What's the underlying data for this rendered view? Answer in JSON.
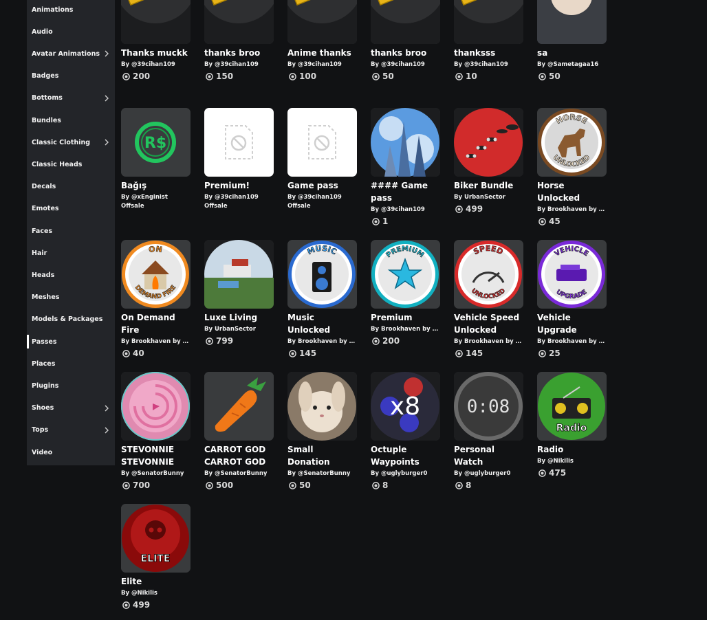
{
  "sidebar": {
    "items": [
      {
        "label": "Animations",
        "chevron": false
      },
      {
        "label": "Audio",
        "chevron": false
      },
      {
        "label": "Avatar Animations",
        "chevron": true
      },
      {
        "label": "Badges",
        "chevron": false
      },
      {
        "label": "Bottoms",
        "chevron": true
      },
      {
        "label": "Bundles",
        "chevron": false
      },
      {
        "label": "Classic Clothing",
        "chevron": true
      },
      {
        "label": "Classic Heads",
        "chevron": false
      },
      {
        "label": "Decals",
        "chevron": false
      },
      {
        "label": "Emotes",
        "chevron": false
      },
      {
        "label": "Faces",
        "chevron": false
      },
      {
        "label": "Hair",
        "chevron": false
      },
      {
        "label": "Heads",
        "chevron": false
      },
      {
        "label": "Meshes",
        "chevron": false
      },
      {
        "label": "Models & Packages",
        "chevron": false
      },
      {
        "label": "Passes",
        "chevron": false,
        "active": true
      },
      {
        "label": "Places",
        "chevron": false
      },
      {
        "label": "Plugins",
        "chevron": false
      },
      {
        "label": "Shoes",
        "chevron": true
      },
      {
        "label": "Tops",
        "chevron": true
      },
      {
        "label": "Video",
        "chevron": false
      }
    ]
  },
  "items": [
    {
      "name": "Thanks muckk",
      "creator": "By @39cihan109",
      "price": "200",
      "thumb": "ticket"
    },
    {
      "name": "thanks broo",
      "creator": "By @39cihan109",
      "price": "150",
      "thumb": "ticket"
    },
    {
      "name": "Anime thanks",
      "creator": "By @39cihan109",
      "price": "100",
      "thumb": "ticket"
    },
    {
      "name": "thanks broo",
      "creator": "By @39cihan109",
      "price": "50",
      "thumb": "ticket"
    },
    {
      "name": "thanksss",
      "creator": "By @39cihan109",
      "price": "10",
      "thumb": "ticket"
    },
    {
      "name": "sa",
      "creator": "By @Sametagaa16",
      "price": "50",
      "thumb": "anime"
    },
    {
      "name": "Bağış",
      "creator": "By @xEnginist",
      "offsale": "Offsale",
      "thumb": "robux"
    },
    {
      "name": "Premium!",
      "creator": "By @39cihan109",
      "offsale": "Offsale",
      "thumb": "placeholder"
    },
    {
      "name": "Game pass",
      "creator": "By @39cihan109",
      "offsale": "Offsale",
      "thumb": "placeholder"
    },
    {
      "name": "#### Game pass",
      "creator": "By @39cihan109",
      "price": "1",
      "thumb": "sky"
    },
    {
      "name": "Biker Bundle",
      "creator": "By UrbanSector",
      "price": "499",
      "thumb": "biker"
    },
    {
      "name": "Horse Unlocked",
      "creator": "By Brookhaven by V...",
      "price": "45",
      "thumb": "horse"
    },
    {
      "name": "On Demand Fire",
      "creator": "By Brookhaven by V...",
      "price": "40",
      "thumb": "fire"
    },
    {
      "name": "Luxe Living",
      "creator": "By UrbanSector",
      "price": "799",
      "thumb": "luxe"
    },
    {
      "name": "Music Unlocked",
      "creator": "By Brookhaven by V...",
      "price": "145",
      "thumb": "music"
    },
    {
      "name": "Premium",
      "creator": "By Brookhaven by V...",
      "price": "200",
      "thumb": "premium"
    },
    {
      "name": "Vehicle Speed Unlocked",
      "creator": "By Brookhaven by V...",
      "price": "145",
      "thumb": "speed"
    },
    {
      "name": "Vehicle Upgrade",
      "creator": "By Brookhaven by V...",
      "price": "25",
      "thumb": "vehicle"
    },
    {
      "name": "STEVONNIE STEVONNIE",
      "creator": "By @SenatorBunny",
      "price": "700",
      "thumb": "steven"
    },
    {
      "name": "CARROT GOD CARROT GOD",
      "creator": "By @SenatorBunny",
      "price": "500",
      "thumb": "carrot"
    },
    {
      "name": "Small Donation",
      "creator": "By @SenatorBunny",
      "price": "50",
      "thumb": "bunny"
    },
    {
      "name": "Octuple Waypoints",
      "creator": "By @uglyburger0",
      "price": "8",
      "thumb": "x8"
    },
    {
      "name": "Personal Watch",
      "creator": "By @uglyburger0",
      "price": "8",
      "thumb": "watch"
    },
    {
      "name": "Radio",
      "creator": "By @Nikilis",
      "price": "475",
      "thumb": "radio"
    },
    {
      "name": "Elite",
      "creator": "By @Nikilis",
      "price": "499",
      "thumb": "elite"
    }
  ],
  "badge_texts": {
    "horse_top": "HORSE",
    "horse_bottom": "UNLOCKED",
    "fire_top": "ON",
    "fire_bottom": "DEMAND FIRE",
    "music_top": "MUSIC",
    "premium_top": "PREMIUM",
    "speed_top": "SPEED",
    "speed_bottom": "UNLOCKED",
    "vehicle_top": "VEHICLE",
    "vehicle_bottom": "UPGRADE",
    "x8": "x8",
    "watch": "0:08",
    "radio": "Radio",
    "elite": "ELITE",
    "robux": "R$"
  },
  "colors": {
    "background": "#111214",
    "sidebar": "#232529",
    "thumb_bg": "#393b3d"
  }
}
